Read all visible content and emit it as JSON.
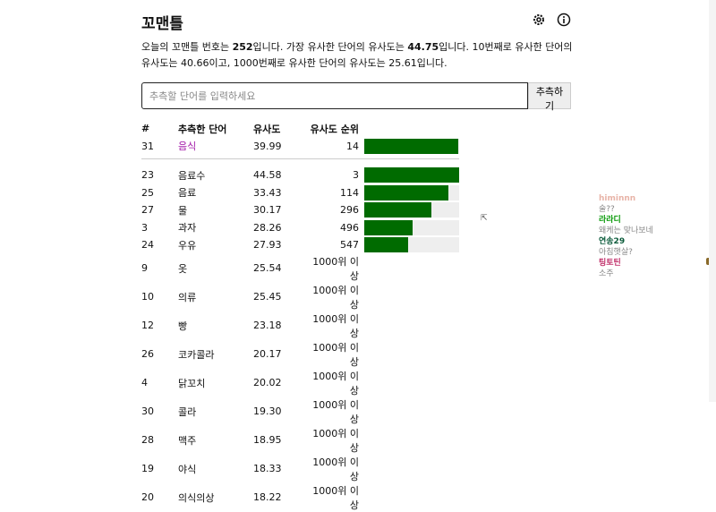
{
  "header": {
    "title": "꼬맨틀",
    "settings_icon": "gear-icon",
    "info_icon": "info-icon"
  },
  "description": {
    "p1": "오늘의 꼬맨틀 번호는 ",
    "num": "252",
    "p2": "입니다. 가장 유사한 단어의 유사도는 ",
    "top": "44.75",
    "p3": "입니다. 10번째로 유사한 단어의 유사도는 40.66이고, 1000번째로 유사한 단어의 유사도는 25.61입니다."
  },
  "guess": {
    "placeholder": "추측할 단어를 입력하세요",
    "button": "추측하기"
  },
  "table": {
    "headers": [
      "#",
      "추측한 단어",
      "유사도",
      "유사도 순위"
    ],
    "latest": {
      "n": "31",
      "word": "음식",
      "sim": "39.99",
      "rank": "14",
      "progress": 0.99
    },
    "rows": [
      {
        "n": "23",
        "word": "음료수",
        "sim": "44.58",
        "rank": "3",
        "progress": 1.0
      },
      {
        "n": "25",
        "word": "음료",
        "sim": "33.43",
        "rank": "114",
        "progress": 0.89
      },
      {
        "n": "27",
        "word": "물",
        "sim": "30.17",
        "rank": "296",
        "progress": 0.71
      },
      {
        "n": "3",
        "word": "과자",
        "sim": "28.26",
        "rank": "496",
        "progress": 0.51
      },
      {
        "n": "24",
        "word": "우유",
        "sim": "27.93",
        "rank": "547",
        "progress": 0.46
      },
      {
        "n": "9",
        "word": "옷",
        "sim": "25.54",
        "rank": "1000위 이상"
      },
      {
        "n": "10",
        "word": "의류",
        "sim": "25.45",
        "rank": "1000위 이상"
      },
      {
        "n": "12",
        "word": "빵",
        "sim": "23.18",
        "rank": "1000위 이상"
      },
      {
        "n": "26",
        "word": "코카콜라",
        "sim": "20.17",
        "rank": "1000위 이상"
      },
      {
        "n": "4",
        "word": "닭꼬치",
        "sim": "20.02",
        "rank": "1000위 이상"
      },
      {
        "n": "30",
        "word": "콜라",
        "sim": "19.30",
        "rank": "1000위 이상"
      },
      {
        "n": "28",
        "word": "맥주",
        "sim": "18.95",
        "rank": "1000위 이상"
      },
      {
        "n": "19",
        "word": "야식",
        "sim": "18.33",
        "rank": "1000위 이상"
      },
      {
        "n": "20",
        "word": "의식의상",
        "sim": "18.22",
        "rank": "1000위 이상"
      }
    ]
  },
  "chat": [
    {
      "name": "himinnn",
      "msg": "술??",
      "color": "#e8b4a8"
    },
    {
      "name": "라라디",
      "msg": "왜케는 맞나보네",
      "color": "#0a9a0a"
    },
    {
      "name": "연송29",
      "msg": "아침햇살?",
      "color": "#0a5a3a"
    },
    {
      "name": "팅토틴",
      "msg": "소주",
      "color": "#c0306a"
    }
  ]
}
